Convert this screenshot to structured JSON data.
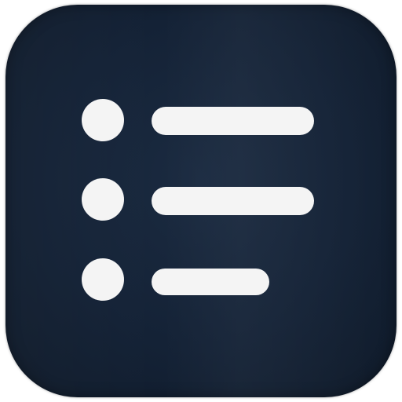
{
  "icon": {
    "name": "bulleted-list-icon",
    "background_color": "#142236",
    "foreground_color": "#f4f4f4",
    "rows": [
      {
        "bullet": "dot",
        "line": "long"
      },
      {
        "bullet": "dot",
        "line": "long"
      },
      {
        "bullet": "dot",
        "line": "short"
      }
    ]
  }
}
